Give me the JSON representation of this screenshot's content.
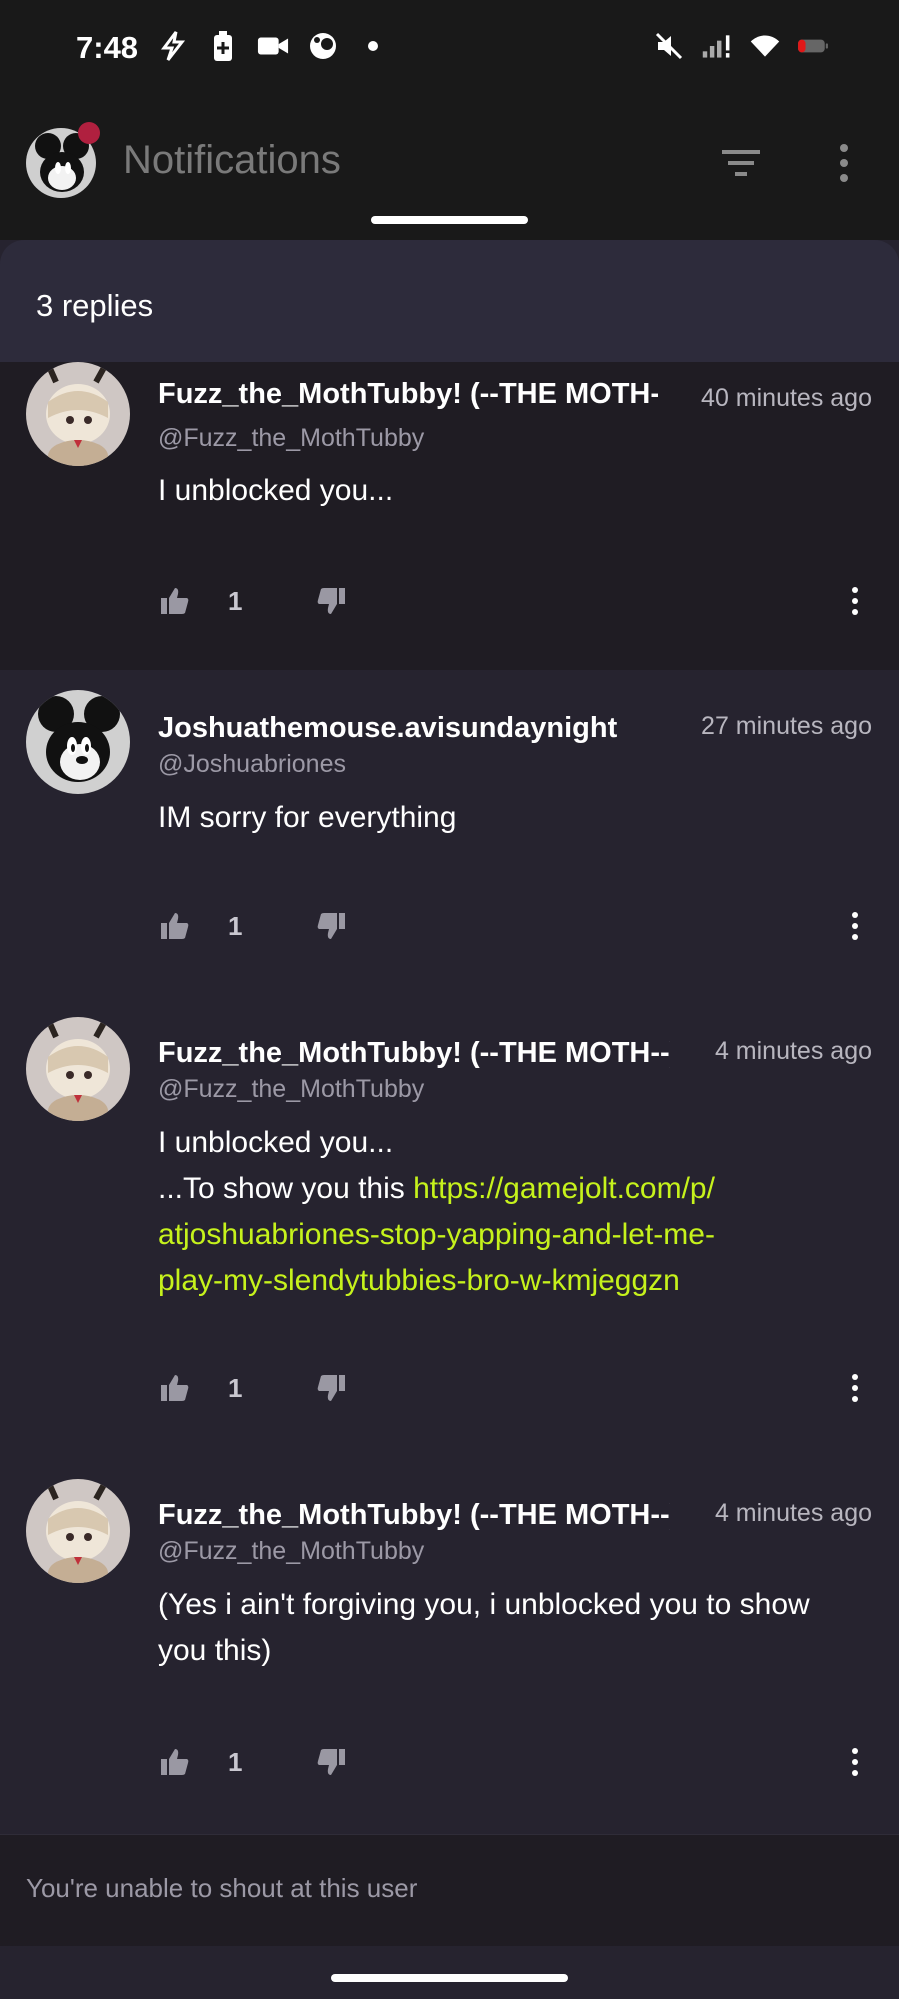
{
  "status_bar": {
    "time": "7:48",
    "left_icons": [
      "flash-icon",
      "battery-saver-icon",
      "video-camera-icon",
      "app-icon",
      "dot-icon"
    ],
    "right_icons": [
      "mute-icon",
      "signal-icon",
      "wifi-icon",
      "battery-icon"
    ]
  },
  "header": {
    "title": "Notifications"
  },
  "sheet": {
    "title": "3 replies"
  },
  "comments": [
    {
      "name": "Fuzz_the_MothTubby! (--THE MOTH--)",
      "handle": "@Fuzz_the_MothTubby",
      "time": "40 minutes ago",
      "body": "I unblocked you...",
      "likes": "1"
    },
    {
      "name": "Joshuathemouse.avisundaynight",
      "handle": "@Joshuabriones",
      "time": "27 minutes ago",
      "body": "IM sorry for everything",
      "likes": "1"
    },
    {
      "name": "Fuzz_the_MothTubby! (--THE MOTH--)",
      "handle": "@Fuzz_the_MothTubby",
      "time": "4 minutes ago",
      "body_line1": "I unblocked you...",
      "body_prefix": "...To show you this ",
      "link_part1": "https://gamejolt.com/p/",
      "link_part2": "atjoshuabriones-stop-yapping-and-let-me-",
      "link_part3": "play-my-slendytubbies-bro-w-kmjeggzn",
      "likes": "1"
    },
    {
      "name": "Fuzz_the_MothTubby! (--THE MOTH--)",
      "handle": "@Fuzz_the_MothTubby",
      "time": "4 minutes ago",
      "body": "(Yes i ain't forgiving you, i unblocked you to show you this)",
      "likes": "1"
    }
  ],
  "footer": {
    "notice": "You're unable to shout at this user"
  },
  "colors": {
    "background": "#26232f",
    "link": "#c6f21c",
    "header_dot": "#b0203f"
  }
}
